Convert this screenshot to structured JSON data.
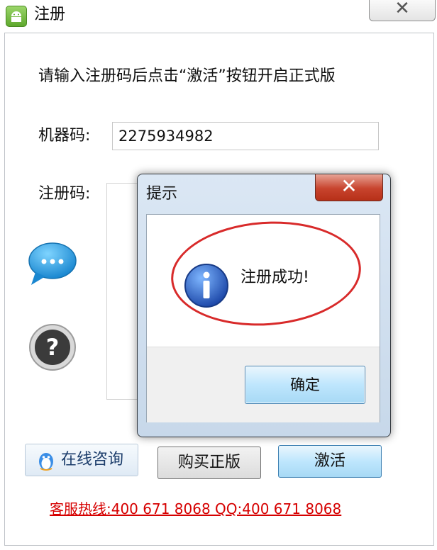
{
  "window": {
    "title": "注册",
    "close_glyph": "✕"
  },
  "main": {
    "instruction": "请输入注册码后点击“激活”按钮开启正式版",
    "machine_code_label": "机器码:",
    "machine_code_value": "2275934982",
    "register_code_label": "注册码:",
    "register_code_value": ""
  },
  "dialog": {
    "title": "提示",
    "close_glyph": "✕",
    "message": "注册成功!",
    "ok_label": "确定",
    "icon": "info-icon",
    "highlight_color": "#d82a2a"
  },
  "buttons": {
    "consult_label": "在线咨询",
    "buy_label": "购买正版",
    "activate_label": "激活"
  },
  "footer": {
    "hotline": "客服热线:400 671 8068 QQ:400 671 8068",
    "hotline_color": "#d60000"
  },
  "icons": [
    "android-app-icon",
    "chat-bubble-icon",
    "help-icon",
    "qq-penguin-icon",
    "info-icon"
  ]
}
